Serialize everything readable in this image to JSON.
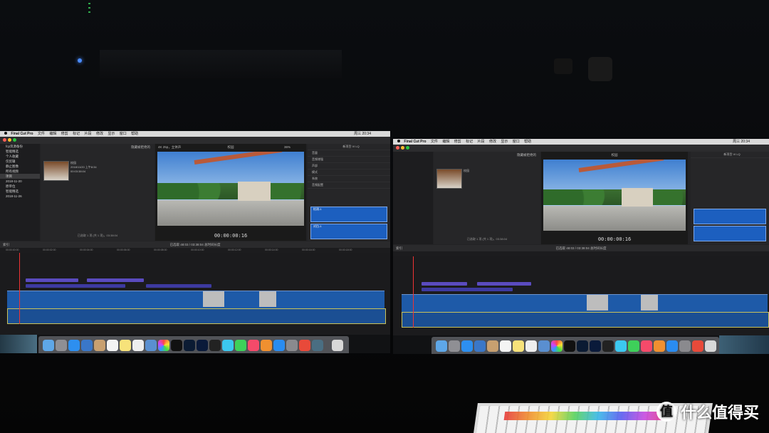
{
  "scene": {
    "watermark_text": "什么值得买",
    "watermark_logo_glyph": "值"
  },
  "monitor_left": {
    "menubar": [
      "Final Cut Pro",
      "文件",
      "编辑",
      "修剪",
      "标记",
      "片段",
      "修改",
      "显示",
      "窗口",
      "帮助"
    ],
    "clock": "周三 20:34",
    "sidebar": [
      "fcp资源备份",
      "智能精选",
      "个人收藏",
      "仅剪辑",
      "静止图像",
      "所有视频",
      "项目",
      "2018-11-20",
      "原单位",
      "智能精选",
      "2018-11-26"
    ],
    "browser_title": "隐藏被拒绝的",
    "clip_name": "校园",
    "clip_meta": [
      "2018/11/20 上午8:34",
      "00:03:38:04"
    ],
    "browser_footer": "已选取 1 项 (共 1 项)，03:38:04",
    "viewer_info": "4K 25p，立体声",
    "viewer_title": "校园",
    "zoom": "36%",
    "display_label": "显示",
    "timecode": "00:00:00:16",
    "inspector_title": "新项目 VI LQ",
    "inspector_duration": "48:03",
    "inspector_rows": [
      "音量",
      "6.0 dB",
      "音频增强",
      "平衡",
      "声部",
      "模式",
      "系统",
      "音频配置",
      "检测-1",
      "立体声",
      "对白-1"
    ],
    "timeline_title": "校园",
    "timeline_status": "已选取 48:03 / 03:38:04 总时间长度",
    "index_label": "索引",
    "ruler_ticks": [
      "00:00:00:00",
      "00:00:02:00",
      "00:00:04:00",
      "00:00:06:00",
      "00:00:08:00",
      "00:00:10:00",
      "00:00:12:00",
      "00:00:14:00",
      "00:00:16:00",
      "00:00:18:00"
    ],
    "lanes": [
      "标题: 基本标题 · 基本",
      "标题: 基本",
      "标题: 基本下三分之一",
      "标题: 基本标题 · 基本",
      "标题: 基本下三分之一"
    ],
    "primary_label": "IMG_0798",
    "primary_caption": "素材已 图片 · 文字",
    "audio_label": "背景音乐"
  },
  "monitor_right": {
    "menubar": [
      "Final Cut Pro",
      "文件",
      "编辑",
      "修剪",
      "标记",
      "片段",
      "修改",
      "显示",
      "窗口",
      "帮助"
    ],
    "clock": "周三 20:34",
    "browser_title": "隐藏被拒绝的",
    "clip_name": "校园",
    "browser_footer": "已选取 1 项 (共 1 项)，03:38:04",
    "viewer_title": "校园",
    "timecode": "00:00:00:16",
    "inspector_title": "新项目 VI LQ",
    "timeline_status": "已选取 48:03 / 03:38:04 总时间长度",
    "index_label": "索引"
  },
  "colors": {
    "clip_blue": "#1e5aa8",
    "title_purple": "#5a4bbf",
    "playhead_red": "#ee3333",
    "selection_yellow": "#c9c25a"
  }
}
